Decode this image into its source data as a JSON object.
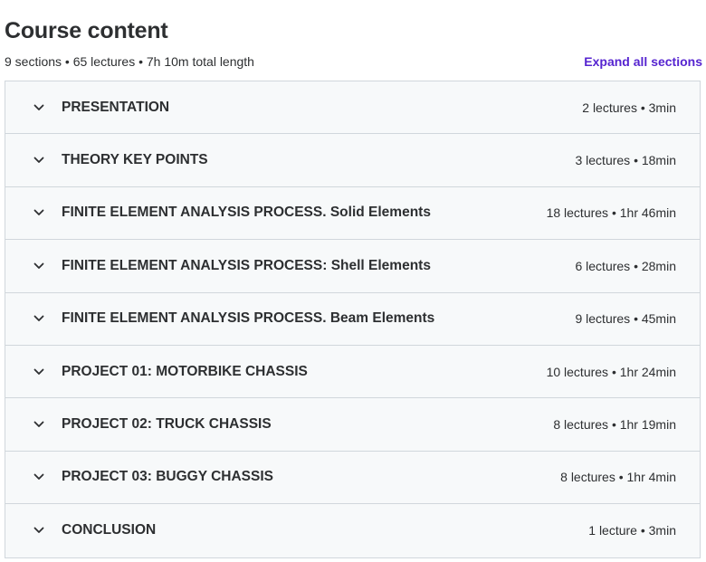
{
  "header": {
    "title": "Course content",
    "summary": "9 sections • 65 lectures • 7h 10m total length",
    "expand_label": "Expand all sections"
  },
  "sections": [
    {
      "title": "PRESENTATION",
      "meta": "2 lectures • 3min"
    },
    {
      "title": "THEORY KEY POINTS",
      "meta": "3 lectures • 18min"
    },
    {
      "title": "FINITE ELEMENT ANALYSIS PROCESS. Solid Elements",
      "meta": "18 lectures • 1hr 46min"
    },
    {
      "title": "FINITE ELEMENT ANALYSIS PROCESS: Shell Elements",
      "meta": "6 lectures • 28min"
    },
    {
      "title": "FINITE ELEMENT ANALYSIS PROCESS. Beam Elements",
      "meta": "9 lectures • 45min"
    },
    {
      "title": "PROJECT 01: MOTORBIKE CHASSIS",
      "meta": "10 lectures • 1hr 24min"
    },
    {
      "title": "PROJECT 02: TRUCK CHASSIS",
      "meta": "8 lectures • 1hr 19min"
    },
    {
      "title": "PROJECT 03: BUGGY CHASSIS",
      "meta": "8 lectures • 1hr 4min"
    },
    {
      "title": "CONCLUSION",
      "meta": "1 lecture • 3min"
    }
  ],
  "icons": {
    "section_toggle": "chevron-down-icon"
  },
  "colors": {
    "text": "#2d2f31",
    "accent": "#5624d0",
    "section_bg": "#f7f9fa",
    "border": "#d1d7dc"
  }
}
